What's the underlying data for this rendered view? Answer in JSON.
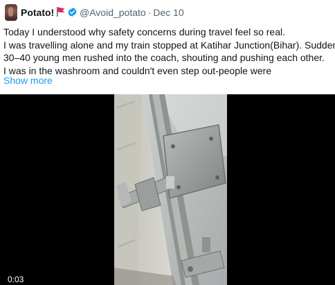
{
  "tweet": {
    "display_name": "Potato!",
    "handle": "@Avoid_potato",
    "separator": "·",
    "date": "Dec 10",
    "lines": [
      "Today I understood why safety concerns during travel feel so real.",
      "I was travelling alone and my train stopped at Katihar Junction(Bihar). Suddenly",
      "30–40 young men rushed into the coach, shouting and pushing each other.",
      "I was in the washroom and couldn't even step out-people were"
    ],
    "show_more": "Show more"
  },
  "video": {
    "time": "0:03"
  },
  "colors": {
    "link": "#1d9bf0",
    "secondary_text": "#536471",
    "verified": "#1d9bf0",
    "flag": "#e0245e"
  },
  "icons": {
    "verified": "verified-badge-icon",
    "flag": "red-flag-emoji"
  }
}
